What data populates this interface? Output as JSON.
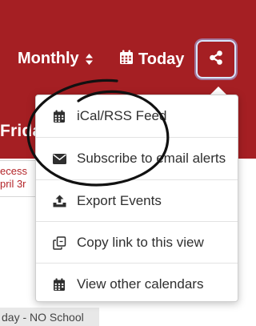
{
  "colors": {
    "brand": "#a51f23",
    "header_text": "#ffffff",
    "focus_ring": "#d8e6ff",
    "menu_text": "#2f2f2f",
    "event_text": "#b32428",
    "annotation": "#111111"
  },
  "header": {
    "view_dropdown": {
      "label": "Monthly",
      "icon": "sort-caret-icon"
    },
    "today_button": {
      "label": "Today",
      "icon": "calendar-icon"
    },
    "share_button": {
      "icon": "share-icon"
    }
  },
  "band": {
    "title_fragment": "Frida"
  },
  "calendar": {
    "event_line_1": "ecess",
    "event_line_2": "pril 3r",
    "bottom_event": "day - NO School"
  },
  "share_menu": {
    "items": [
      {
        "label": "iCal/RSS Feed",
        "icon": "calendar-icon"
      },
      {
        "label": "Subscribe to email alerts",
        "icon": "envelope-icon"
      },
      {
        "label": "Export Events",
        "icon": "export-icon"
      },
      {
        "label": "Copy link to this view",
        "icon": "copy-link-icon"
      },
      {
        "label": "View other calendars",
        "icon": "calendar-icon"
      }
    ]
  }
}
